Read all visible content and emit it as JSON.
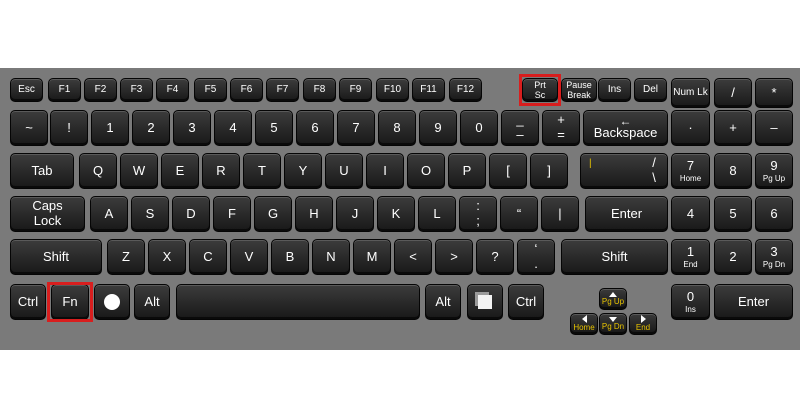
{
  "keys": {
    "esc": "Esc",
    "f1": "F1",
    "f2": "F2",
    "f3": "F3",
    "f4": "F4",
    "f5": "F5",
    "f6": "F6",
    "f7": "F7",
    "f8": "F8",
    "f9": "F9",
    "f10": "F10",
    "f11": "F11",
    "f12": "F12",
    "prtsc_1": "Prt",
    "prtsc_2": "Sc",
    "pause_1": "Pause",
    "pause_2": "Break",
    "ins": "Ins",
    "del": "Del",
    "numlk": "Num Lk",
    "num_div": "/",
    "num_mul": "*",
    "tilde": "~",
    "excl": "!",
    "n1": "1",
    "n2": "2",
    "n3": "3",
    "n4": "4",
    "n5": "5",
    "n6": "6",
    "n7": "7",
    "n8": "8",
    "n9": "9",
    "n0": "0",
    "minus_top": "_",
    "minus_bot": "–",
    "plus_top": "+",
    "plus_bot": "=",
    "backspace": "Backspace",
    "bs_arrow": "←",
    "num_dot": "·",
    "num_plus": "+",
    "num_minus": "–",
    "tab": "Tab",
    "q": "Q",
    "w": "W",
    "e": "E",
    "r": "R",
    "t": "T",
    "y": "Y",
    "u": "U",
    "i": "I",
    "o": "O",
    "p": "P",
    "lbracket": "[",
    "rbracket": "]",
    "pipe_top": "/",
    "pipe_bot": "\\",
    "pipe_left": "|",
    "num7": "7",
    "num7_sub": "Home",
    "num8": "8",
    "num9": "9",
    "num9_sub": "Pg Up",
    "caps_1": "Caps",
    "caps_2": "Lock",
    "a": "A",
    "s": "S",
    "d": "D",
    "f": "F",
    "g": "G",
    "h": "H",
    "j": "J",
    "k": "K",
    "l": "L",
    "semi_top": ":",
    "semi_bot": ";",
    "quote": "“",
    "apos": "|",
    "enter": "Enter",
    "num4": "4",
    "num5": "5",
    "num6": "6",
    "shift": "Shift",
    "z": "Z",
    "x": "X",
    "c": "C",
    "v": "V",
    "b": "B",
    "n": "N",
    "m": "M",
    "lt": "<",
    "gt": ">",
    "qmark": "?",
    "slash_top": "‘",
    "slash_bot": ".",
    "num1": "1",
    "num1_sub": "End",
    "num2": "2",
    "num3": "3",
    "num3_sub": "Pg Dn",
    "ctrl": "Ctrl",
    "fn": "Fn",
    "alt": "Alt",
    "altgr": "Alt",
    "pgup": "Pg Up",
    "home": "Home",
    "pgdn": "Pg Dn",
    "end": "End",
    "num0": "0",
    "num0_sub": "Ins",
    "num_enter": "Enter"
  },
  "icons": {
    "os_key": "circle-logo-icon",
    "menu_key": "window-square-icon"
  },
  "colors": {
    "highlight": "#d81e1e",
    "key_face": "#1e1e1e",
    "keyboard_bg": "#7a7a7a",
    "sub_label": "#e8c400"
  }
}
